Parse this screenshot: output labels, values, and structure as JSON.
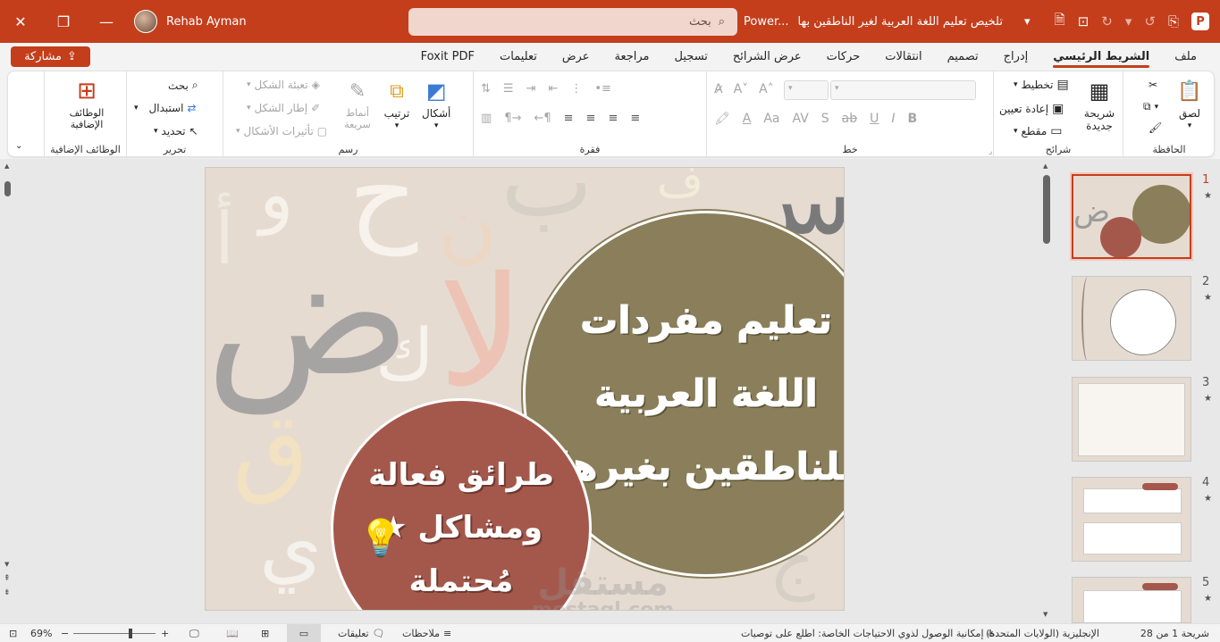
{
  "titlebar": {
    "user_name": "Rehab Ayman",
    "search_placeholder": "بحث",
    "app_short": "Power...",
    "doc_title": "تلخيص تعليم اللغة العربية لغير الناطقين بها"
  },
  "tabs": [
    "ملف",
    "الشريط الرئيسي",
    "إدراج",
    "تصميم",
    "انتقالات",
    "حركات",
    "عرض الشرائح",
    "تسجيل",
    "مراجعة",
    "عرض",
    "تعليمات",
    "Foxit PDF"
  ],
  "share_label": "مشاركة",
  "ribbon": {
    "clipboard": {
      "paste": "لصق",
      "label": "الحافظة"
    },
    "slides": {
      "new_slide": "شريحة جديدة",
      "layout": "تخطيط",
      "reset": "إعادة تعيين",
      "section": "مقطع",
      "label": "شرائح"
    },
    "font": {
      "label": "خط"
    },
    "paragraph": {
      "label": "فقرة"
    },
    "drawing": {
      "shapes": "أشكال",
      "arrange": "ترتيب",
      "quick_styles": "أنماط سريعة",
      "fill": "تعبئة الشكل",
      "outline": "إطار الشكل",
      "effects": "تأثيرات الأشكال",
      "label": "رسم"
    },
    "editing": {
      "find": "بحث",
      "replace": "استبدال",
      "select": "تحديد",
      "label": "تحرير"
    },
    "addins": {
      "addins": "الوظائف الإضافية",
      "label": "الوظائف الإضافية"
    }
  },
  "slide": {
    "title_lines": [
      "تعليم مفردات",
      "اللغة العربية",
      "للناطقين بغيرها"
    ],
    "sub_lines": [
      "طرائق فعالة",
      "★ ومشاكل",
      "مُحتملة"
    ],
    "watermark": "مستقل",
    "watermark_url": "mostaql.com"
  },
  "thumbnails": [
    {
      "num": "1",
      "star": "★"
    },
    {
      "num": "2",
      "star": "★"
    },
    {
      "num": "3",
      "star": "★"
    },
    {
      "num": "4",
      "star": "★"
    },
    {
      "num": "5",
      "star": "★"
    }
  ],
  "status": {
    "slide_info": "شريحة 1 من 28",
    "language": "الإنجليزية (الولايات المتحدة)",
    "accessibility": "إمكانية الوصول لذوي الاحتياجات الخاصة: اطلع على توصيات",
    "notes": "ملاحظات",
    "comments": "تعليقات",
    "zoom": "69%"
  },
  "colors": {
    "accent": "#c43e1c",
    "olive": "#8a7f5a",
    "rust": "#a4584c",
    "slide_bg": "#e6dbd1"
  }
}
